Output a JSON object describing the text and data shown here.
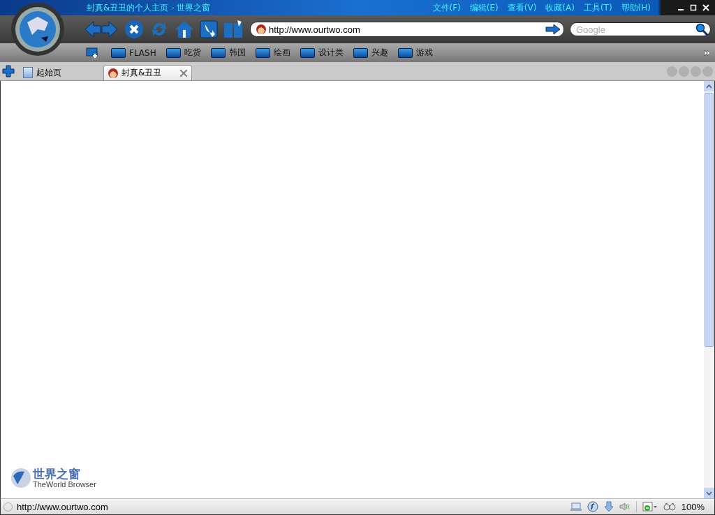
{
  "window": {
    "title": "封真&丑丑的个人主页 - 世界之窗"
  },
  "menu": [
    "文件(F)",
    "编辑(E)",
    "查看(V)",
    "收藏(A)",
    "工具(T)",
    "帮助(H)"
  ],
  "address": {
    "value": "http://www.ourtwo.com"
  },
  "search": {
    "placeholder": "Google"
  },
  "bookmarks": [
    "FLASH",
    "吃货",
    "韩国",
    "绘画",
    "设计类",
    "兴趣",
    "游戏"
  ],
  "tabs": [
    {
      "label": "起始页",
      "selected": false,
      "kind": "page"
    },
    {
      "label": "封真&丑丑",
      "selected": true,
      "kind": "site"
    }
  ],
  "watermark": {
    "title": "世界之窗",
    "subtitle": "TheWorld Browser"
  },
  "status_bar": {
    "url": "http://www.ourtwo.com",
    "zoom": "100%"
  }
}
